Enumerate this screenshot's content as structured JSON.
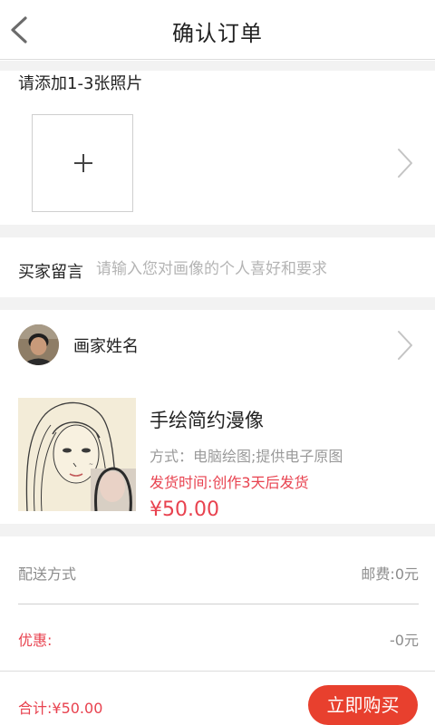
{
  "header": {
    "title": "确认订单"
  },
  "photos": {
    "label": "请添加1-3张照片"
  },
  "message": {
    "label": "买家留言",
    "placeholder": "请输入您对画像的个人喜好和要求",
    "value": ""
  },
  "artist": {
    "name": "画家姓名"
  },
  "product": {
    "title": "手绘简约漫像",
    "method": "方式：电脑绘图;提供电子原图",
    "shipping": "发货时间:创作3天后发货",
    "price": "¥50.00"
  },
  "delivery": {
    "label": "配送方式",
    "fee": "邮费:0元"
  },
  "discount": {
    "label": "优惠:",
    "value": "-0元"
  },
  "footer": {
    "total": "合计:¥50.00",
    "buy_label": "立即购买"
  },
  "colors": {
    "accent": "#e8424f",
    "button": "#e8402e",
    "separator": "#f2f2f2"
  },
  "icons": {
    "back": "chevron-left-icon",
    "add": "plus-icon",
    "more": "chevron-right-icon"
  }
}
